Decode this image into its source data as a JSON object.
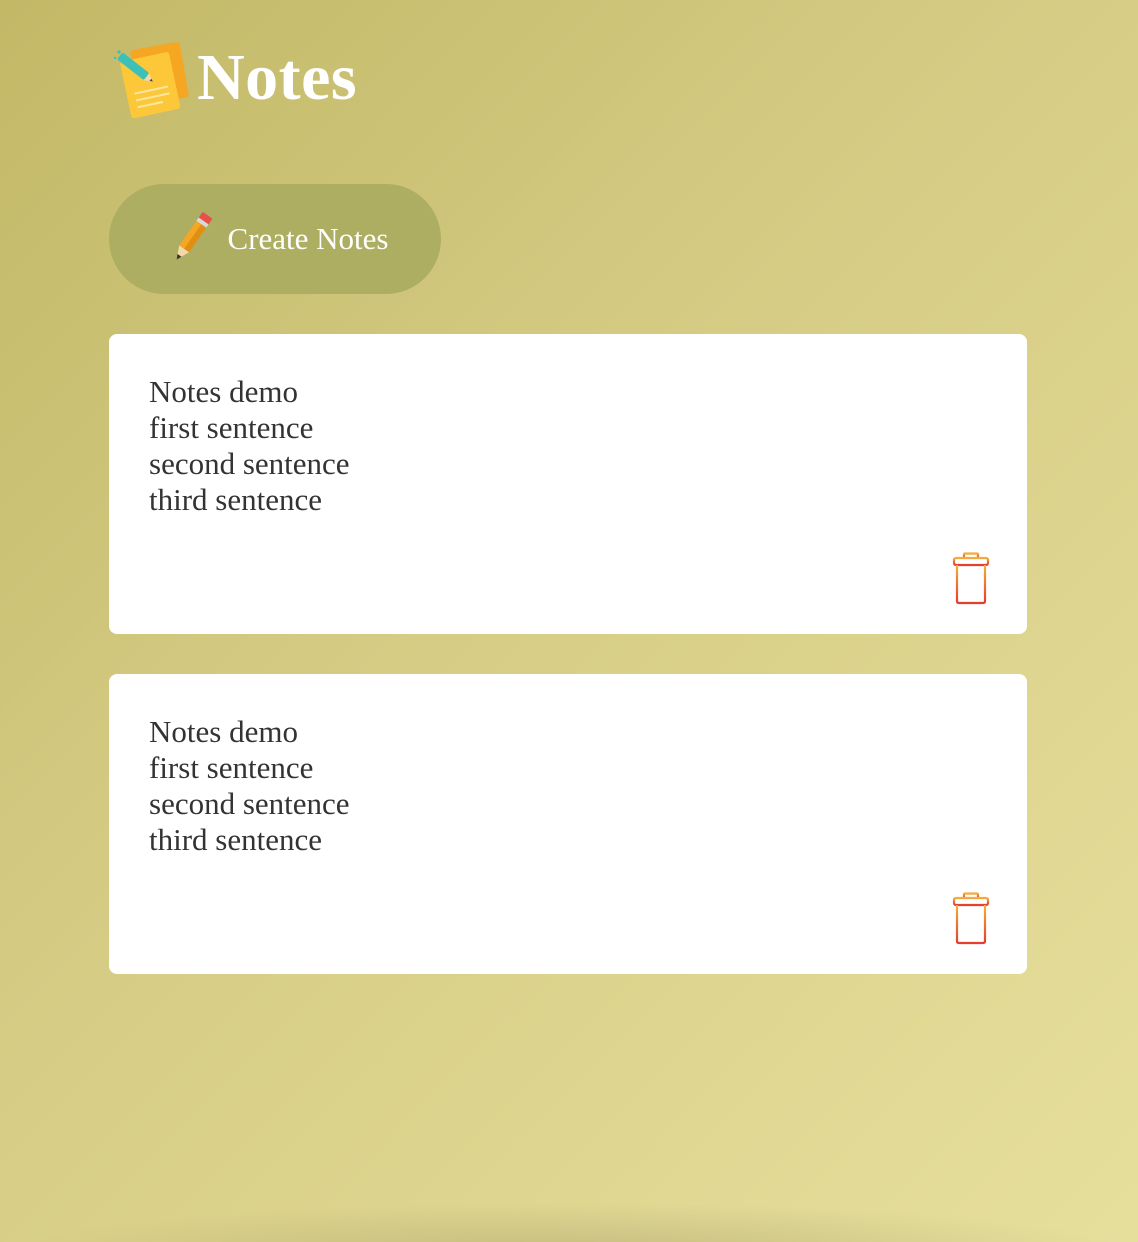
{
  "app": {
    "title": "Notes",
    "logo_icon": "sticky-notes-icon"
  },
  "toolbar": {
    "create_label": "Create Notes",
    "create_icon": "pencil-icon",
    "button_color": "#adae62"
  },
  "notes": [
    {
      "text": "Notes demo\nfirst sentence\nsecond sentence\nthird sentence",
      "delete_icon": "trash-icon"
    },
    {
      "text": "Notes demo\nfirst sentence\nsecond sentence\nthird sentence",
      "delete_icon": "trash-icon"
    }
  ],
  "colors": {
    "background_start": "#c2b866",
    "background_end": "#e6df9c",
    "card": "#ffffff",
    "text": "#333333",
    "trash_top": "#f2b13a",
    "trash_bottom": "#e43c2e"
  }
}
